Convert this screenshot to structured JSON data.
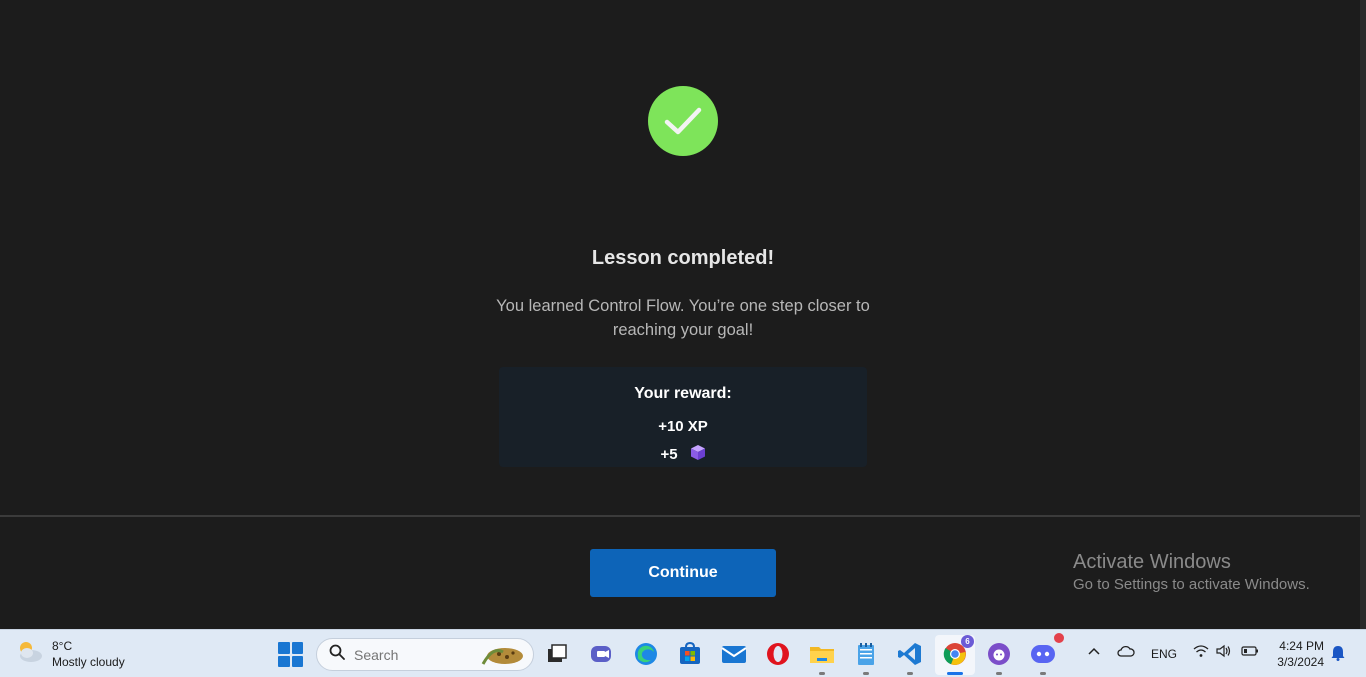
{
  "lesson": {
    "title": "Lesson completed!",
    "subtitle": "You learned Control Flow. You’re one step closer to reaching your goal!",
    "reward_title": "Your reward:",
    "xp": "+10 XP",
    "gems": "+5",
    "continue_label": "Continue"
  },
  "watermark": {
    "line1": "Activate Windows",
    "line2": "Go to Settings to activate Windows."
  },
  "taskbar": {
    "weather_temp": "8°C",
    "weather_desc": "Mostly cloudy",
    "search_placeholder": "Search",
    "language": "ENG",
    "time": "4:24 PM",
    "date": "3/3/2024",
    "chrome_badge": "6"
  },
  "colors": {
    "success": "#7ee45a",
    "primary_button": "#0d64b8",
    "background": "#1c1c1c",
    "reward_card": "#182028"
  }
}
